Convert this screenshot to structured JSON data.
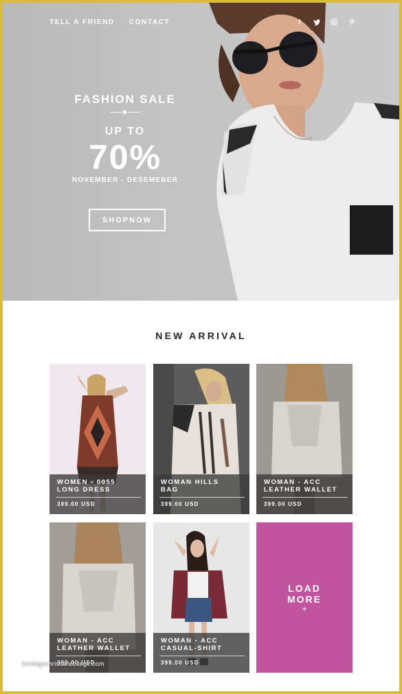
{
  "nav": {
    "links": [
      "TELL A FRIEND",
      "CONTACT"
    ],
    "social_icons": [
      "facebook-icon",
      "twitter-icon",
      "instagram-icon",
      "pinterest-icon"
    ]
  },
  "promo": {
    "title": "FASHION SALE",
    "up_to": "UP TO",
    "percent": "70%",
    "dates": "NOVEMBER - DESEMEBER",
    "button": "SHOPNOW"
  },
  "section": {
    "title": "NEW ARRIVAL"
  },
  "products": [
    {
      "name": "WOMEN - 0055\nLONG DRESS",
      "price": "399.00 USD"
    },
    {
      "name": "WOMAN HILLS\nBAG",
      "price": "399.00 USD"
    },
    {
      "name": "WOMAN - ACC\nLEATHER WALLET",
      "price": "399.00 USD"
    },
    {
      "name": "WOMAN - ACC\nLEATHER WALLET",
      "price": "399.00 USD"
    },
    {
      "name": "WOMAN - ACC\nCASUAL-SHIRT",
      "price": "399.00 USD"
    }
  ],
  "load_more": {
    "label": "LOAD\nMORE",
    "icon": "+"
  },
  "watermark": "heritagechristiancollege.com",
  "colors": {
    "frame": "#d9bd3a",
    "load_more": "#c2549f",
    "overlay": "#3a3a3a"
  }
}
